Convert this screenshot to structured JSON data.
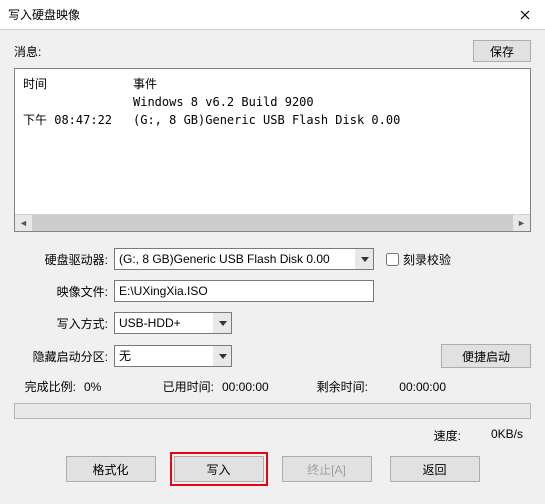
{
  "titlebar": {
    "title": "写入硬盘映像"
  },
  "msg": {
    "label": "消息:",
    "save": "保存"
  },
  "log": {
    "header_time": "时间",
    "header_event": "事件",
    "rows": [
      {
        "time": "",
        "event": "Windows 8 v6.2 Build 9200"
      },
      {
        "time": "下午 08:47:22",
        "event": "(G:, 8 GB)Generic USB Flash Disk  0.00"
      }
    ]
  },
  "form": {
    "disk_label": "硬盘驱动器:",
    "disk_value": "(G:, 8 GB)Generic USB Flash Disk  0.00",
    "verify_label": "刻录校验",
    "image_label": "映像文件:",
    "image_value": "E:\\UXingXia.ISO",
    "method_label": "写入方式:",
    "method_value": "USB-HDD+",
    "hidepart_label": "隐藏启动分区:",
    "hidepart_value": "无",
    "convenient": "便捷启动"
  },
  "progress": {
    "done_label": "完成比例:",
    "done_value": "0%",
    "elapsed_label": "已用时间:",
    "elapsed_value": "00:00:00",
    "remain_label": "剩余时间:",
    "remain_value": "00:00:00"
  },
  "speed": {
    "label": "速度:",
    "value": "0KB/s"
  },
  "buttons": {
    "format": "格式化",
    "write": "写入",
    "abort": "终止[A]",
    "back": "返回"
  }
}
